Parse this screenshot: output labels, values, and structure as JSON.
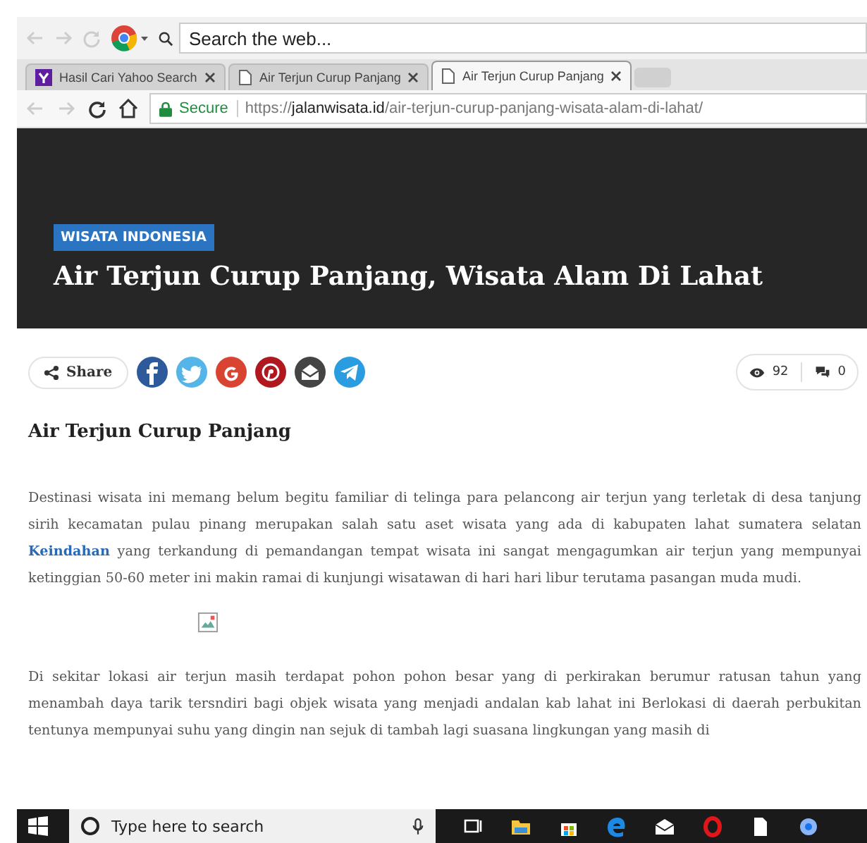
{
  "toolbar": {
    "search": {
      "placeholder": "Search the web..."
    }
  },
  "tabs": [
    {
      "label": "Hasil Cari Yahoo Search",
      "kind": "yahoo",
      "selected": false
    },
    {
      "label": "Air Terjun Curup Panjang",
      "kind": "page",
      "selected": false
    },
    {
      "label": "Air Terjun Curup Panjang",
      "kind": "page",
      "selected": true
    }
  ],
  "address_bar": {
    "secure_label": "Secure",
    "url_scheme": "https://",
    "url_host": "jalanwisata.id",
    "url_path": "/air-terjun-curup-panjang-wisata-alam-di-lahat/"
  },
  "hero": {
    "category": "WISATA INDONESIA",
    "title": "Air Terjun Curup Panjang, Wisata Alam Di Lahat"
  },
  "share": {
    "label": "Share",
    "buttons": [
      {
        "kind": "facebook",
        "color": "#2d5a9a"
      },
      {
        "kind": "twitter",
        "color": "#55b5e8"
      },
      {
        "kind": "google",
        "color": "#d94332"
      },
      {
        "kind": "pinterest",
        "color": "#b0171f"
      },
      {
        "kind": "email",
        "color": "#444444"
      },
      {
        "kind": "telegram",
        "color": "#2a9de0"
      }
    ],
    "views": "92",
    "comments": "0"
  },
  "article": {
    "heading": "Air Terjun Curup Panjang",
    "paragraphs": [
      "Destinasi wisata ini memang belum begitu familiar di telinga para pelancong air terjun yang terletak di desa tanjung sirih kecamatan pulau pinang merupakan salah satu aset wisata yang ada di kabupaten lahat sumatera selatan **Keindahan** yang terkandung di pemandangan tempat wisata ini sangat mengagumkan air terjun yang mempunyai ketinggian 50-60 meter ini makin ramai di kunjungi wisatawan di hari hari libur terutama pasangan muda mudi.",
      "Di sekitar lokasi air terjun masih terdapat pohon pohon besar yang di perkirakan berumur ratusan tahun yang menambah daya tarik tersndiri bagi objek wisata yang menjadi andalan kab lahat ini Berlokasi di daerah perbukitan tentunya mempunyai suhu yang dingin nan sejuk di tambah lagi suasana lingkungan yang masih di"
    ]
  },
  "taskbar": {
    "search_placeholder": "Type here to search"
  }
}
